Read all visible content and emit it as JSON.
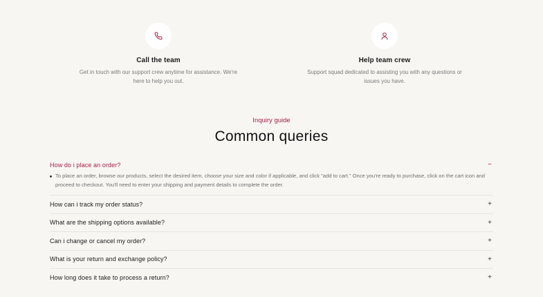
{
  "contacts": [
    {
      "icon": "phone-icon",
      "title": "Call the team",
      "description": "Get in touch with our support crew anytime for assistance. We're here to help you out."
    },
    {
      "icon": "user-icon",
      "title": "Help team crew",
      "description": "Support squad dedicated to assisting you with any questions or issues you have."
    }
  ],
  "faq": {
    "eyebrow": "Inquiry guide",
    "title": "Common queries",
    "items": [
      {
        "question": "How do i place an order?",
        "toggle": "−",
        "open": true,
        "answer": "To place an order, browse our products, select the desired item, choose your size and color if applicable, and click \"add to cart.\" Once you're ready to purchase, click on the cart icon and proceed to checkout. You'll need to enter your shipping and payment details to complete the order."
      },
      {
        "question": "How can i track my order status?",
        "toggle": "+",
        "open": false
      },
      {
        "question": "What are the shipping options available?",
        "toggle": "+",
        "open": false
      },
      {
        "question": "Can i change or cancel my order?",
        "toggle": "+",
        "open": false
      },
      {
        "question": "What is your return and exchange policy?",
        "toggle": "+",
        "open": false
      },
      {
        "question": "How long does it take to process a return?",
        "toggle": "+",
        "open": false
      }
    ]
  },
  "colors": {
    "accent": "#a31d43",
    "background": "#f8f6f3"
  }
}
